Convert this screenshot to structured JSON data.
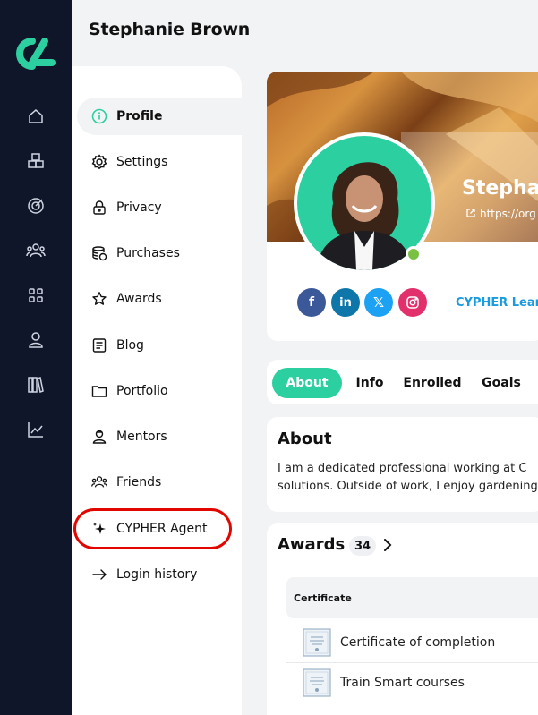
{
  "header": {
    "title": "Stephanie Brown"
  },
  "rail": {
    "icons": [
      "logo-icon",
      "home-icon",
      "cubes-icon",
      "target-icon",
      "users-icon",
      "grid-icon",
      "person-icon",
      "library-icon",
      "chart-icon"
    ]
  },
  "settings_nav": {
    "items": [
      {
        "label": "Profile",
        "icon": "info-icon",
        "active": true
      },
      {
        "label": "Settings",
        "icon": "gear-icon"
      },
      {
        "label": "Privacy",
        "icon": "lock-icon"
      },
      {
        "label": "Purchases",
        "icon": "coins-icon"
      },
      {
        "label": "Awards",
        "icon": "star-icon"
      },
      {
        "label": "Blog",
        "icon": "document-icon"
      },
      {
        "label": "Portfolio",
        "icon": "folder-icon"
      },
      {
        "label": "Mentors",
        "icon": "mentor-icon"
      },
      {
        "label": "Friends",
        "icon": "friends-icon"
      },
      {
        "label": "CYPHER Agent",
        "icon": "sparkle-icon",
        "highlighted": true
      },
      {
        "label": "Login history",
        "icon": "arrow-right-icon"
      }
    ]
  },
  "profile": {
    "name": "Stepha",
    "link": "https://org",
    "organization": "CYPHER Learn",
    "social": [
      "facebook-icon",
      "linkedin-icon",
      "x-icon",
      "instagram-icon"
    ],
    "online": true
  },
  "tabs": [
    {
      "label": "About",
      "active": true
    },
    {
      "label": "Info"
    },
    {
      "label": "Enrolled"
    },
    {
      "label": "Goals"
    }
  ],
  "about": {
    "title": "About",
    "line1": "I am a dedicated professional working at C",
    "line2": "solutions. Outside of work, I enjoy gardening"
  },
  "awards": {
    "title": "Awards",
    "count": "34",
    "column_header": "Certificate",
    "rows": [
      {
        "label": "Certificate of completion"
      },
      {
        "label": "Train Smart courses"
      }
    ]
  },
  "colors": {
    "rail_bg": "#0f1629",
    "accent": "#2ccfa0",
    "brand_blue": "#1a9be0",
    "highlight_ring": "#e10600",
    "online": "#7ac143"
  }
}
